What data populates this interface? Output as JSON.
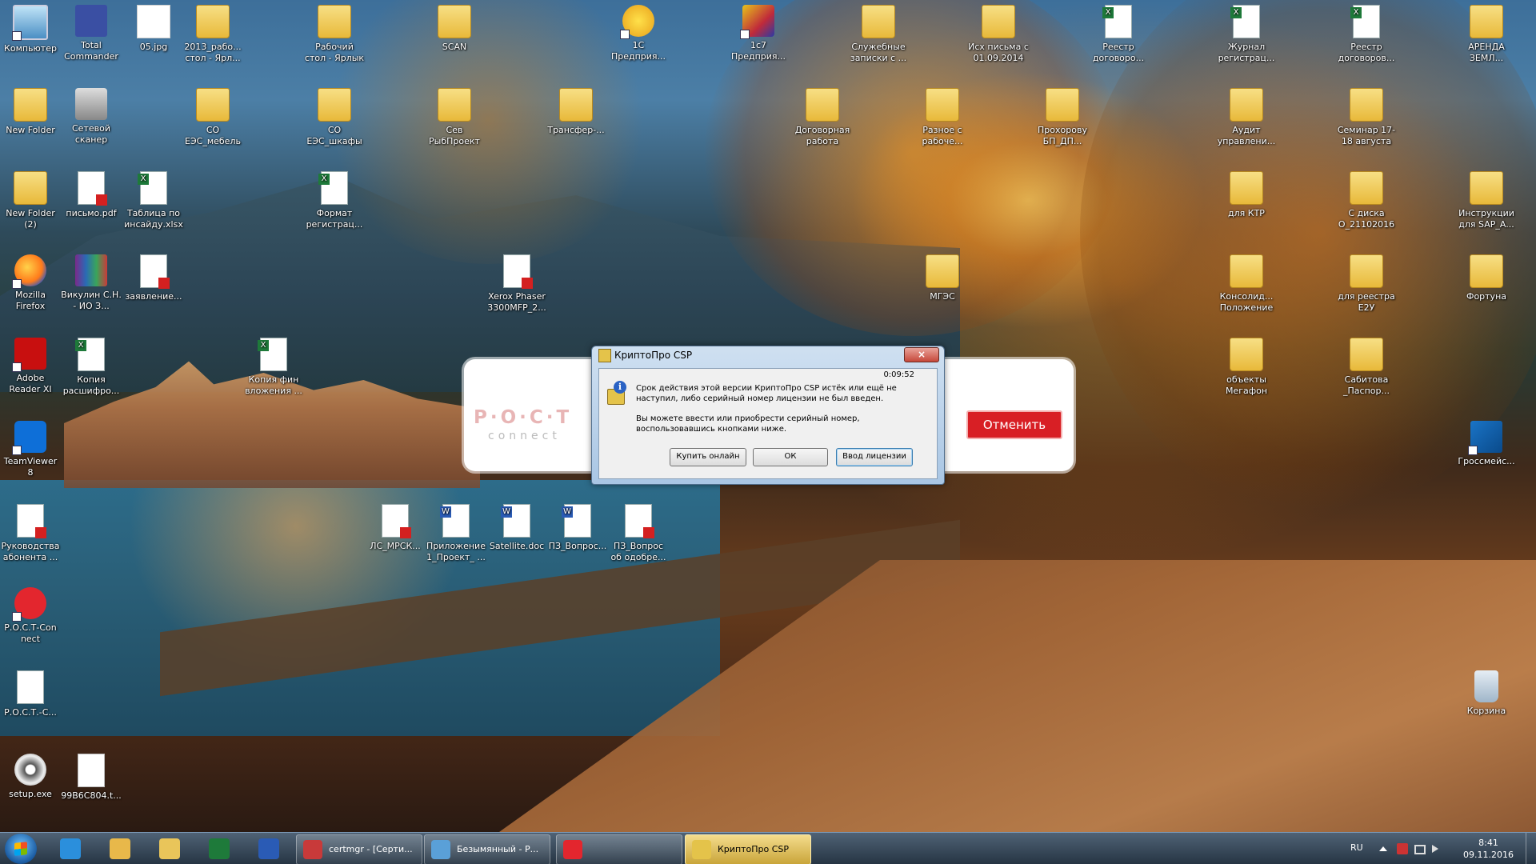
{
  "desktop_icons": [
    {
      "label": "Компьютер",
      "type": "computer"
    },
    {
      "label": "Total Commander",
      "type": "floppy"
    },
    {
      "label": "05.jpg",
      "type": "img"
    },
    {
      "label": "2013_рабо... стол - Ярл...",
      "type": "folder"
    },
    {
      "label": "Рабочий стол - Ярлык",
      "type": "folder"
    },
    {
      "label": "SCAN",
      "type": "folder"
    },
    {
      "label": "1С Предприя...",
      "type": "1c"
    },
    {
      "label": "1с7 Предприя...",
      "type": "1c7"
    },
    {
      "label": "Служебные записки с ...",
      "type": "folder"
    },
    {
      "label": "Исх письма с 01.09.2014",
      "type": "folder"
    },
    {
      "label": "Реестр договоро...",
      "type": "xls"
    },
    {
      "label": "Журнал регистрац...",
      "type": "xls"
    },
    {
      "label": "Реестр договоров...",
      "type": "xls"
    },
    {
      "label": "АРЕНДА ЗЕМЛ...",
      "type": "folder"
    },
    {
      "label": "New Folder",
      "type": "folder"
    },
    {
      "label": "Сетевой сканер",
      "type": "scanner"
    },
    {
      "label": "СО ЕЭС_мебель",
      "type": "folder"
    },
    {
      "label": "СО ЕЭС_шкафы",
      "type": "folder"
    },
    {
      "label": "Сев РыбПроект",
      "type": "folder"
    },
    {
      "label": "Трансфер-...",
      "type": "folder"
    },
    {
      "label": "Договорная работа",
      "type": "folder"
    },
    {
      "label": "Разное с рабоче...",
      "type": "folder"
    },
    {
      "label": "Прохорову БП_ДП...",
      "type": "folder"
    },
    {
      "label": "Аудит управлени...",
      "type": "folder"
    },
    {
      "label": "Семинар 17-18 августа",
      "type": "folder"
    },
    {
      "label": "New Folder (2)",
      "type": "folder"
    },
    {
      "label": "письмо.pdf",
      "type": "pdf"
    },
    {
      "label": "Таблица по инсайду.xlsx",
      "type": "xls"
    },
    {
      "label": "Формат регистрац...",
      "type": "xls"
    },
    {
      "label": "для КТР",
      "type": "folder"
    },
    {
      "label": "С диска О_21102016",
      "type": "folder"
    },
    {
      "label": "Инструкции для SAP_A...",
      "type": "folder"
    },
    {
      "label": "Mozilla Firefox",
      "type": "firefox"
    },
    {
      "label": "Викулин С.Н. - ИО З...",
      "type": "rar"
    },
    {
      "label": "заявление...",
      "type": "pdf"
    },
    {
      "label": "Xerox Phaser 3300MFP_2...",
      "type": "pdf"
    },
    {
      "label": "МГЭС",
      "type": "folder"
    },
    {
      "label": "Консолид... Положение",
      "type": "folder"
    },
    {
      "label": "для реестра E2У",
      "type": "folder"
    },
    {
      "label": "Фортуна",
      "type": "folder"
    },
    {
      "label": "Adobe Reader XI",
      "type": "adobe"
    },
    {
      "label": "Копия расшифро...",
      "type": "xls"
    },
    {
      "label": "Копия фин вложения ...",
      "type": "xls"
    },
    {
      "label": "объекты Мегафон",
      "type": "folder"
    },
    {
      "label": "Сабитова _Паспор...",
      "type": "folder"
    },
    {
      "label": "TeamViewer 8",
      "type": "teamviewer"
    },
    {
      "label": "Гроссмейс...",
      "type": "rosreg"
    },
    {
      "label": "Руководства абонента ...",
      "type": "pdf"
    },
    {
      "label": "ЛС_МРСК...",
      "type": "pdf"
    },
    {
      "label": "Приложение 1_Проект_ ...",
      "type": "word"
    },
    {
      "label": "Satellite.doc",
      "type": "word"
    },
    {
      "label": "ПЗ_Вопрос...",
      "type": "word"
    },
    {
      "label": "ПЗ_Вопрос об одобре...",
      "type": "pdf"
    },
    {
      "label": "Р.О.С.Т-Con nect",
      "type": "rostct"
    },
    {
      "label": "Р.О.С.Т.-С...",
      "type": "doc"
    },
    {
      "label": "Корзина",
      "type": "recycle"
    },
    {
      "label": "setup.exe",
      "type": "setup"
    },
    {
      "label": "99B6C804.t...",
      "type": "blank"
    }
  ],
  "rost_window": {
    "logo": "Р·О·С·Т",
    "logo_sub": "connect",
    "cancel_label": "Отменить"
  },
  "dialog": {
    "title": "КриптоПро CSP",
    "close_glyph": "×",
    "timer": "0:09:52",
    "message1": "Срок действия этой версии КриптоПро CSP истёк или ещё не наступил, либо серийный номер лицензии не был введен.",
    "message2": "Вы можете ввести или приобрести серийный номер, воспользовавшись кнопками ниже.",
    "buttons": {
      "buy": "Купить онлайн",
      "ok": "ОК",
      "license": "Ввод лицензии"
    }
  },
  "taskbar": {
    "pinned": [
      {
        "name": "internet-explorer",
        "color": "#2b8fdc"
      },
      {
        "name": "outlook",
        "color": "#e8b84a"
      },
      {
        "name": "explorer",
        "color": "#e9c55a"
      },
      {
        "name": "excel",
        "color": "#1e7a3a"
      },
      {
        "name": "word",
        "color": "#2a5bb5"
      }
    ],
    "windows": [
      {
        "label": "certmgr - [Серти...",
        "color": "#c83a3a",
        "active": false
      },
      {
        "label": "Безымянный - Р...",
        "color": "#5aa0d8",
        "active": false
      },
      {
        "label": "",
        "color": "#e3262e",
        "active": false
      },
      {
        "label": "КриптоПро CSP",
        "color": "#e4c34a",
        "active": true
      }
    ],
    "tray": {
      "language": "RU",
      "time": "8:41",
      "date": "09.11.2016"
    }
  },
  "colors": {
    "cancel_red": "#d81f25",
    "dialog_frame": "#a9c6e4",
    "taskbar": "#2a3c50"
  }
}
